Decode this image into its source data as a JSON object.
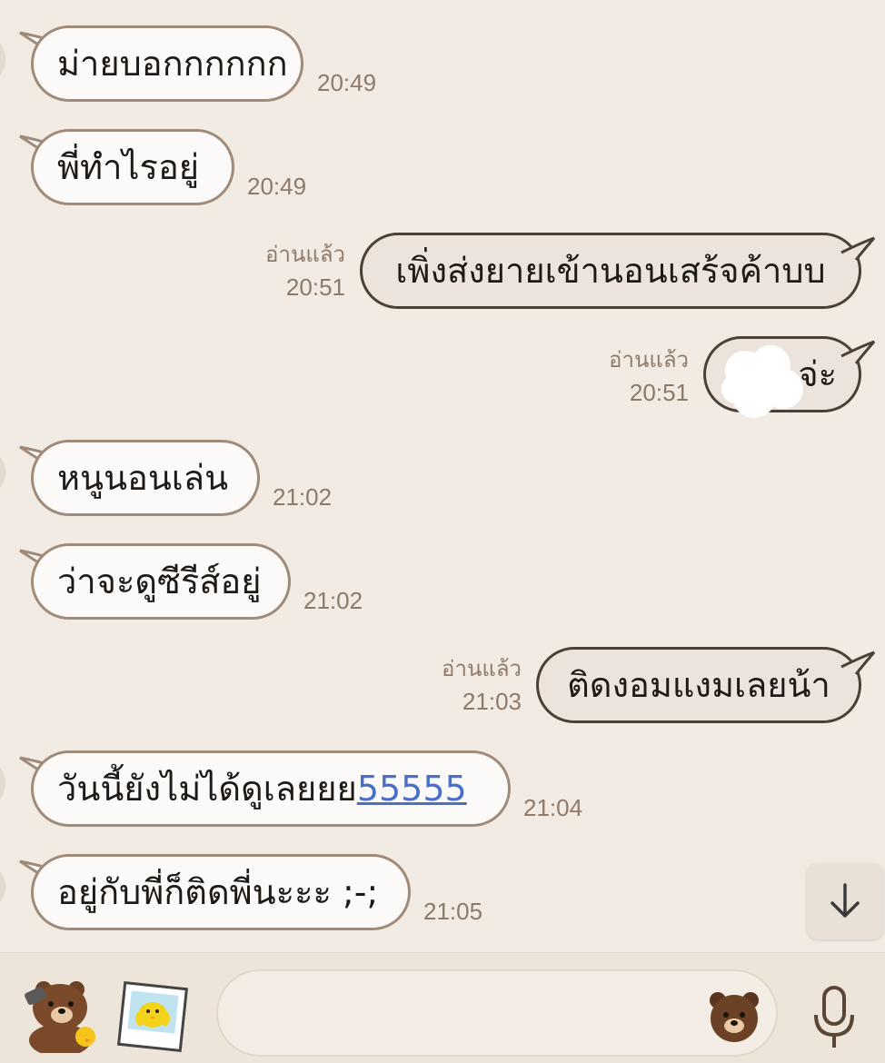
{
  "messages": [
    {
      "dir": "in",
      "text": "ม่ายบอกกกกกก",
      "time": "20:49"
    },
    {
      "dir": "in",
      "text": "พี่ทำไรอยู่",
      "time": "20:49"
    },
    {
      "dir": "out",
      "text": "เพิ่งส่งยายเข้านอนเสร้จค้าบบ",
      "read": "อ่านแล้ว",
      "time": "20:51"
    },
    {
      "dir": "out",
      "text": "จ่ะ",
      "read": "อ่านแล้ว",
      "time": "20:51",
      "obscured": true
    },
    {
      "dir": "in",
      "text": "หนูนอนเล่น",
      "time": "21:02"
    },
    {
      "dir": "in",
      "text": "ว่าจะดูซีรีส์อยู่",
      "time": "21:02"
    },
    {
      "dir": "out",
      "text": "ติดงอมแงมเลยน้า",
      "read": "อ่านแล้ว",
      "time": "21:03"
    },
    {
      "dir": "in",
      "text_before_link": "วันนี้ยังไม่ได้ดูเลยยย",
      "link_text": "55555",
      "time": "21:04"
    },
    {
      "dir": "in",
      "text": "อยู่กับพี่ก็ติดพี่นะะะ ;-;",
      "time": "21:05"
    }
  ],
  "controls": {
    "scroll_down_icon": "arrow-down-icon",
    "sticker_icon": "bear-sticker-icon",
    "photo_icon": "photo-sticker-icon",
    "emoji_icon": "bear-emoji-icon",
    "mic_icon": "microphone-icon",
    "input_value": ""
  },
  "colors": {
    "background": "#f1ebe4",
    "incoming_bubble": "#fbfaf8",
    "incoming_border": "#a08a78",
    "outgoing_bubble": "#ece4dc",
    "outgoing_border": "#4a4038",
    "timestamp": "#8e7a68",
    "link": "#4a6fc8"
  }
}
